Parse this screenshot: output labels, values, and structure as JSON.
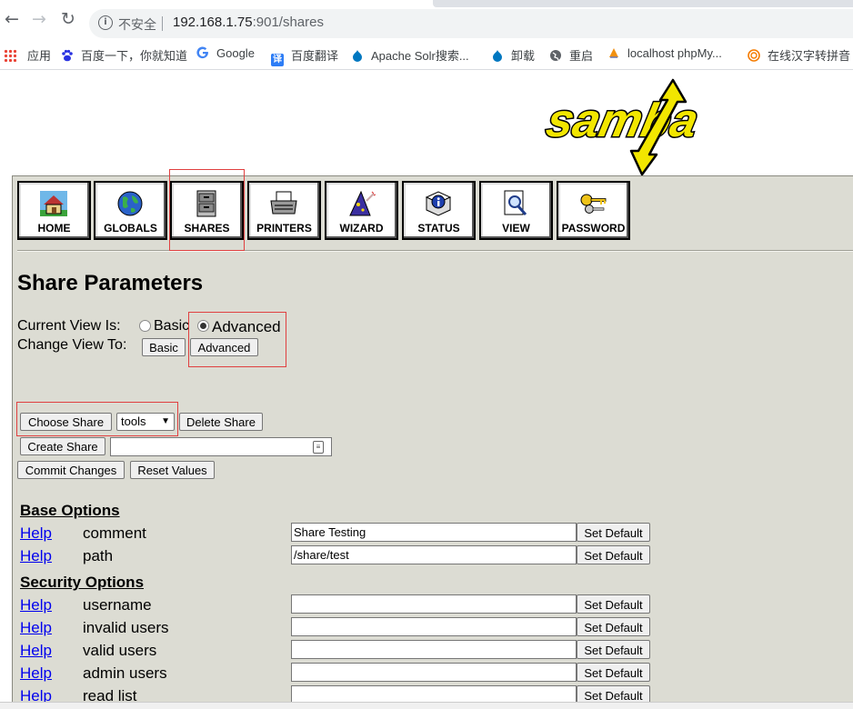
{
  "browser": {
    "insecure_label": "不安全",
    "url_host": "192.168.1.75",
    "url_rest": ":901/shares",
    "bookmarks": [
      {
        "label": "应用",
        "icon": "apps-grid-icon",
        "color": "#ea4335"
      },
      {
        "label": "百度一下，你就知道",
        "icon": "baidu-paw-icon",
        "color": "#2932e1"
      },
      {
        "label": "Google",
        "icon": "google-g-icon",
        "color": "#4285f4"
      },
      {
        "label": "百度翻译",
        "icon": "translate-icon",
        "color": "#2d7df6"
      },
      {
        "label": "Apache Solr搜索...",
        "icon": "drupal-drop-icon",
        "color": "#0077c0"
      },
      {
        "label": "卸载",
        "icon": "drupal-drop-icon",
        "color": "#0077c0"
      },
      {
        "label": "重启",
        "icon": "globe-icon",
        "color": "#5f6368"
      },
      {
        "label": "localhost phpMy...",
        "icon": "phpmyadmin-sail-icon",
        "color": "#f29111"
      },
      {
        "label": "在线汉字转拼音",
        "icon": "spiral-icon",
        "color": "#f57c00"
      }
    ]
  },
  "logo_text": "samba",
  "nav": [
    {
      "label": "HOME",
      "icon": "home-icon"
    },
    {
      "label": "GLOBALS",
      "icon": "globe-icon"
    },
    {
      "label": "SHARES",
      "icon": "file-cabinet-icon"
    },
    {
      "label": "PRINTERS",
      "icon": "printer-icon"
    },
    {
      "label": "WIZARD",
      "icon": "wizard-hat-icon"
    },
    {
      "label": "STATUS",
      "icon": "info-book-icon"
    },
    {
      "label": "VIEW",
      "icon": "magnifier-doc-icon"
    },
    {
      "label": "PASSWORD",
      "icon": "keys-icon"
    }
  ],
  "page_title": "Share Parameters",
  "view": {
    "current_label": "Current View Is:",
    "basic": "Basic",
    "advanced": "Advanced",
    "selected": "Advanced",
    "change_label": "Change View To:",
    "basic_button": "Basic",
    "advanced_button": "Advanced"
  },
  "share_controls": {
    "choose_button": "Choose Share",
    "selected_share": "tools",
    "delete_button": "Delete Share",
    "create_button": "Create Share",
    "create_value": "",
    "commit_button": "Commit Changes",
    "reset_button": "Reset Values"
  },
  "help_label": "Help",
  "set_default_label": "Set Default",
  "sections": [
    {
      "title": "Base Options",
      "params": [
        {
          "name": "comment",
          "value": "Share Testing"
        },
        {
          "name": "path",
          "value": "/share/test"
        }
      ]
    },
    {
      "title": "Security Options",
      "params": [
        {
          "name": "username",
          "value": ""
        },
        {
          "name": "invalid users",
          "value": ""
        },
        {
          "name": "valid users",
          "value": ""
        },
        {
          "name": "admin users",
          "value": ""
        },
        {
          "name": "read list",
          "value": ""
        }
      ]
    }
  ]
}
